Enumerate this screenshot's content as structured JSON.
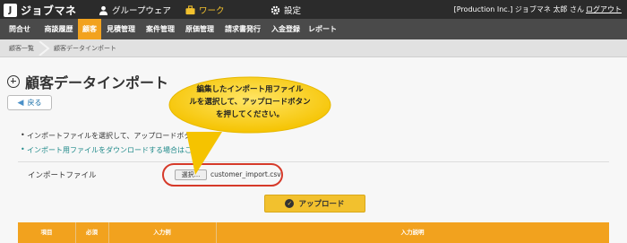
{
  "app": {
    "brand_logo": "J",
    "brand_name": "ジョブマネ"
  },
  "topnav": {
    "groupware": "グループウェア",
    "work": "ワーク",
    "settings": "設定",
    "user": "[Production Inc.] ジョブマネ 太郎 さん",
    "logout": "ログアウト"
  },
  "menu": [
    "問合せ",
    "商談履歴",
    "顧客",
    "見積管理",
    "案件管理",
    "原価管理",
    "請求書発行",
    "入金登録",
    "レポート"
  ],
  "breadcrumb": [
    "顧客一覧",
    "顧客データインポート"
  ],
  "page": {
    "title": "顧客データインポート",
    "back": "戻る"
  },
  "info": {
    "line1": "インポートファイルを選択して、アップロードボタ",
    "line2": "インポート用ファイルをダウンロードする場合はここを"
  },
  "form": {
    "label": "インポートファイル",
    "choose": "選択...",
    "filename": "customer_import.csv"
  },
  "upload": {
    "label": "アップロード"
  },
  "table": {
    "headers": [
      "項目",
      "必須",
      "入力例",
      "入力説明"
    ]
  },
  "callout": {
    "line1": "編集したインポート用ファイル",
    "line2": "ルを選択して、アップロードボタン",
    "line3": "を押してください。"
  },
  "colors": {
    "accent": "#f2a21e",
    "button": "#f2c12e",
    "highlight": "#d63a2a",
    "topbar": "#2b2b2b"
  }
}
